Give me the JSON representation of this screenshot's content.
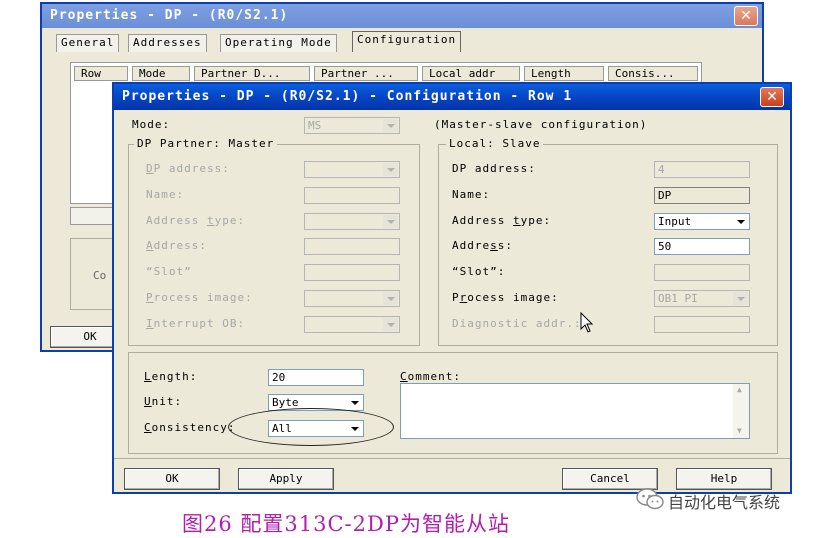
{
  "back_window": {
    "title": "Properties - DP - (R0/S2.1)",
    "tabs": [
      "General",
      "Addresses",
      "Operating Mode",
      "Configuration"
    ],
    "columns": [
      "Row",
      "Mode",
      "Partner D...",
      "Partner ...",
      "Local addr",
      "Length",
      "Consis..."
    ],
    "partial_text": "Co",
    "ok_label": "OK"
  },
  "dialog": {
    "title": "Properties - DP - (R0/S2.1) - Configuration - Row 1",
    "mode_label": "Mode:",
    "mode_value": "MS",
    "mode_note": "(Master-slave configuration)",
    "partner_group": {
      "title": "DP Partner: Master",
      "labels": [
        "DP address:",
        "Name:",
        "Address type:",
        "Address:",
        "“Slot”",
        "Process image:",
        "Interrupt OB:"
      ]
    },
    "local_group": {
      "title": "Local: Slave",
      "dp_address_label": "DP address:",
      "dp_address_value": "4",
      "name_label": "Name:",
      "name_value": "DP",
      "address_type_label": "Address type:",
      "address_type_value": "Input",
      "address_label": "Address:",
      "address_value": "50",
      "slot_label": "“Slot”:",
      "process_image_label": "Process image:",
      "process_image_value": "OB1 PI",
      "diagnostic_label": "Diagnostic addr.:"
    },
    "length_label": "Length:",
    "length_value": "20",
    "unit_label": "Unit:",
    "unit_value": "Byte",
    "consistency_label": "Consistency:",
    "consistency_value": "All",
    "comment_label": "Comment:",
    "buttons": {
      "ok": "OK",
      "apply": "Apply",
      "cancel": "Cancel",
      "help": "Help"
    }
  },
  "caption": "图26  配置313C-2DP为智能从站",
  "watermark": "自动化电气系统",
  "colors": {
    "titlebar": "#0a5fe0",
    "caption": "#b01fb0",
    "dialog_bg": "#ece9d8"
  }
}
